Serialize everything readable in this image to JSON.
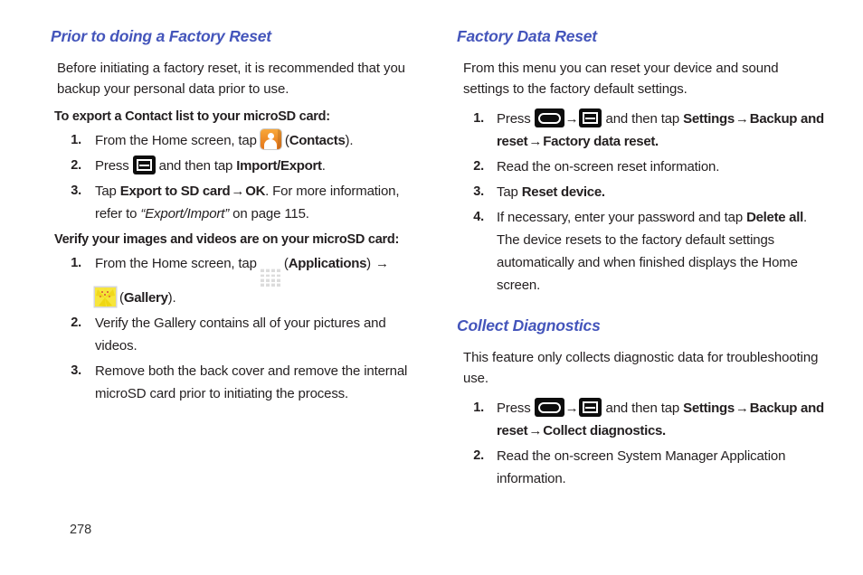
{
  "document": {
    "page_number": "278",
    "heading_color": "#4455bb",
    "text_color": "#231f20"
  },
  "left_column": {
    "heading": "Prior to doing a Factory Reset",
    "intro": "Before initiating a factory reset, it is recommended that you backup your personal data prior to use.",
    "subheading_1": "To export a Contact list to your microSD card:",
    "steps_1": [
      {
        "num": "1.",
        "t1": "From the Home screen, tap ",
        "icon": "contacts-icon",
        "t2": " (",
        "b1": "Contacts",
        "t3": ")."
      },
      {
        "num": "2.",
        "t1": "Press ",
        "icon": "menu-key-icon",
        "t2": " and then tap ",
        "b1": "Import/Export",
        "t3": "."
      },
      {
        "num": "3.",
        "t1": "Tap ",
        "b1": "Export to SD card",
        "arrow": "→",
        "b2": "OK",
        "t2": ". For more information, refer to ",
        "i1": "“Export/Import”",
        "t3": " on page 115."
      }
    ],
    "subheading_2": "Verify your images and videos are on your microSD card:",
    "steps_2": [
      {
        "num": "1.",
        "t1": "From the Home screen, tap ",
        "icon_a": "applications-icon",
        "t2": " (",
        "b1": "Applications",
        "t3": ") ",
        "arrow": "→",
        "icon_b": "gallery-icon",
        "t4": " (",
        "b2": "Gallery",
        "t5": ")."
      },
      {
        "num": "2.",
        "t1": "Verify the Gallery contains all of your pictures and videos."
      },
      {
        "num": "3.",
        "t1": "Remove both the back cover and remove the internal microSD card prior to initiating the process."
      }
    ]
  },
  "right_column": {
    "heading_1": "Factory Data Reset",
    "intro_1": "From this menu you can reset your device and sound settings to the factory default settings.",
    "steps_1": [
      {
        "num": "1.",
        "t1": "Press ",
        "icon_a": "home-key-icon",
        "arrow1": "→",
        "icon_b": "menu-key-icon",
        "t2": " and then tap ",
        "b1": "Settings",
        "arrow2": "→",
        "b2": "Backup and reset",
        "arrow3": "→",
        "b3": "Factory data reset."
      },
      {
        "num": "2.",
        "t1": "Read the on-screen reset information."
      },
      {
        "num": "3.",
        "t1": "Tap ",
        "b1": "Reset device."
      },
      {
        "num": "4.",
        "t1": "If necessary, enter your password and tap ",
        "b1": "Delete all",
        "t2": ". The device resets to the factory default settings automatically and when finished displays the Home screen."
      }
    ],
    "heading_2": "Collect Diagnostics",
    "intro_2": "This feature only collects diagnostic data for troubleshooting use.",
    "steps_2": [
      {
        "num": "1.",
        "t1": "Press ",
        "icon_a": "home-key-icon",
        "arrow1": "→",
        "icon_b": "menu-key-icon",
        "t2": " and then tap ",
        "b1": "Settings",
        "arrow2": "→",
        "b2": "Backup and reset",
        "arrow3": "→",
        "b3": "Collect diagnostics."
      },
      {
        "num": "2.",
        "t1": "Read the on-screen System Manager Application information."
      }
    ]
  }
}
